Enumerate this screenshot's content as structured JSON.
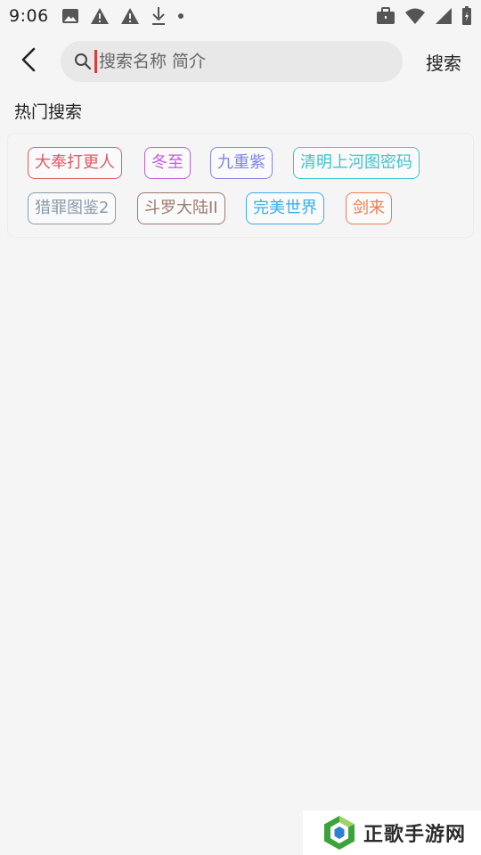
{
  "status_bar": {
    "time": "9:06",
    "left_icons": [
      "image-icon",
      "warning-icon",
      "warning-icon",
      "download-icon",
      "dot-icon"
    ],
    "right_icons": [
      "briefcase-icon",
      "wifi-icon",
      "signal-icon",
      "battery-icon"
    ]
  },
  "header": {
    "back_icon": "chevron-left-icon",
    "search_placeholder": "搜索名称 简介",
    "search_value": "",
    "search_button_label": "搜索"
  },
  "hot_search": {
    "title": "热门搜索",
    "tags": [
      {
        "label": "大奉打更人",
        "color": "#e05a63"
      },
      {
        "label": "冬至",
        "color": "#c05fd6"
      },
      {
        "label": "九重紫",
        "color": "#7f86e8"
      },
      {
        "label": "清明上河图密码",
        "color": "#3bc5cf"
      },
      {
        "label": "猎罪图鉴2",
        "color": "#8a9bab"
      },
      {
        "label": "斗罗大陆II",
        "color": "#9a7a70"
      },
      {
        "label": "完美世界",
        "color": "#3aaee8"
      },
      {
        "label": "剑来",
        "color": "#f07a50"
      }
    ]
  },
  "watermark": {
    "text": "正歌手游网",
    "logo": "hexagon-logo-icon",
    "accent": "#3aa33a"
  }
}
